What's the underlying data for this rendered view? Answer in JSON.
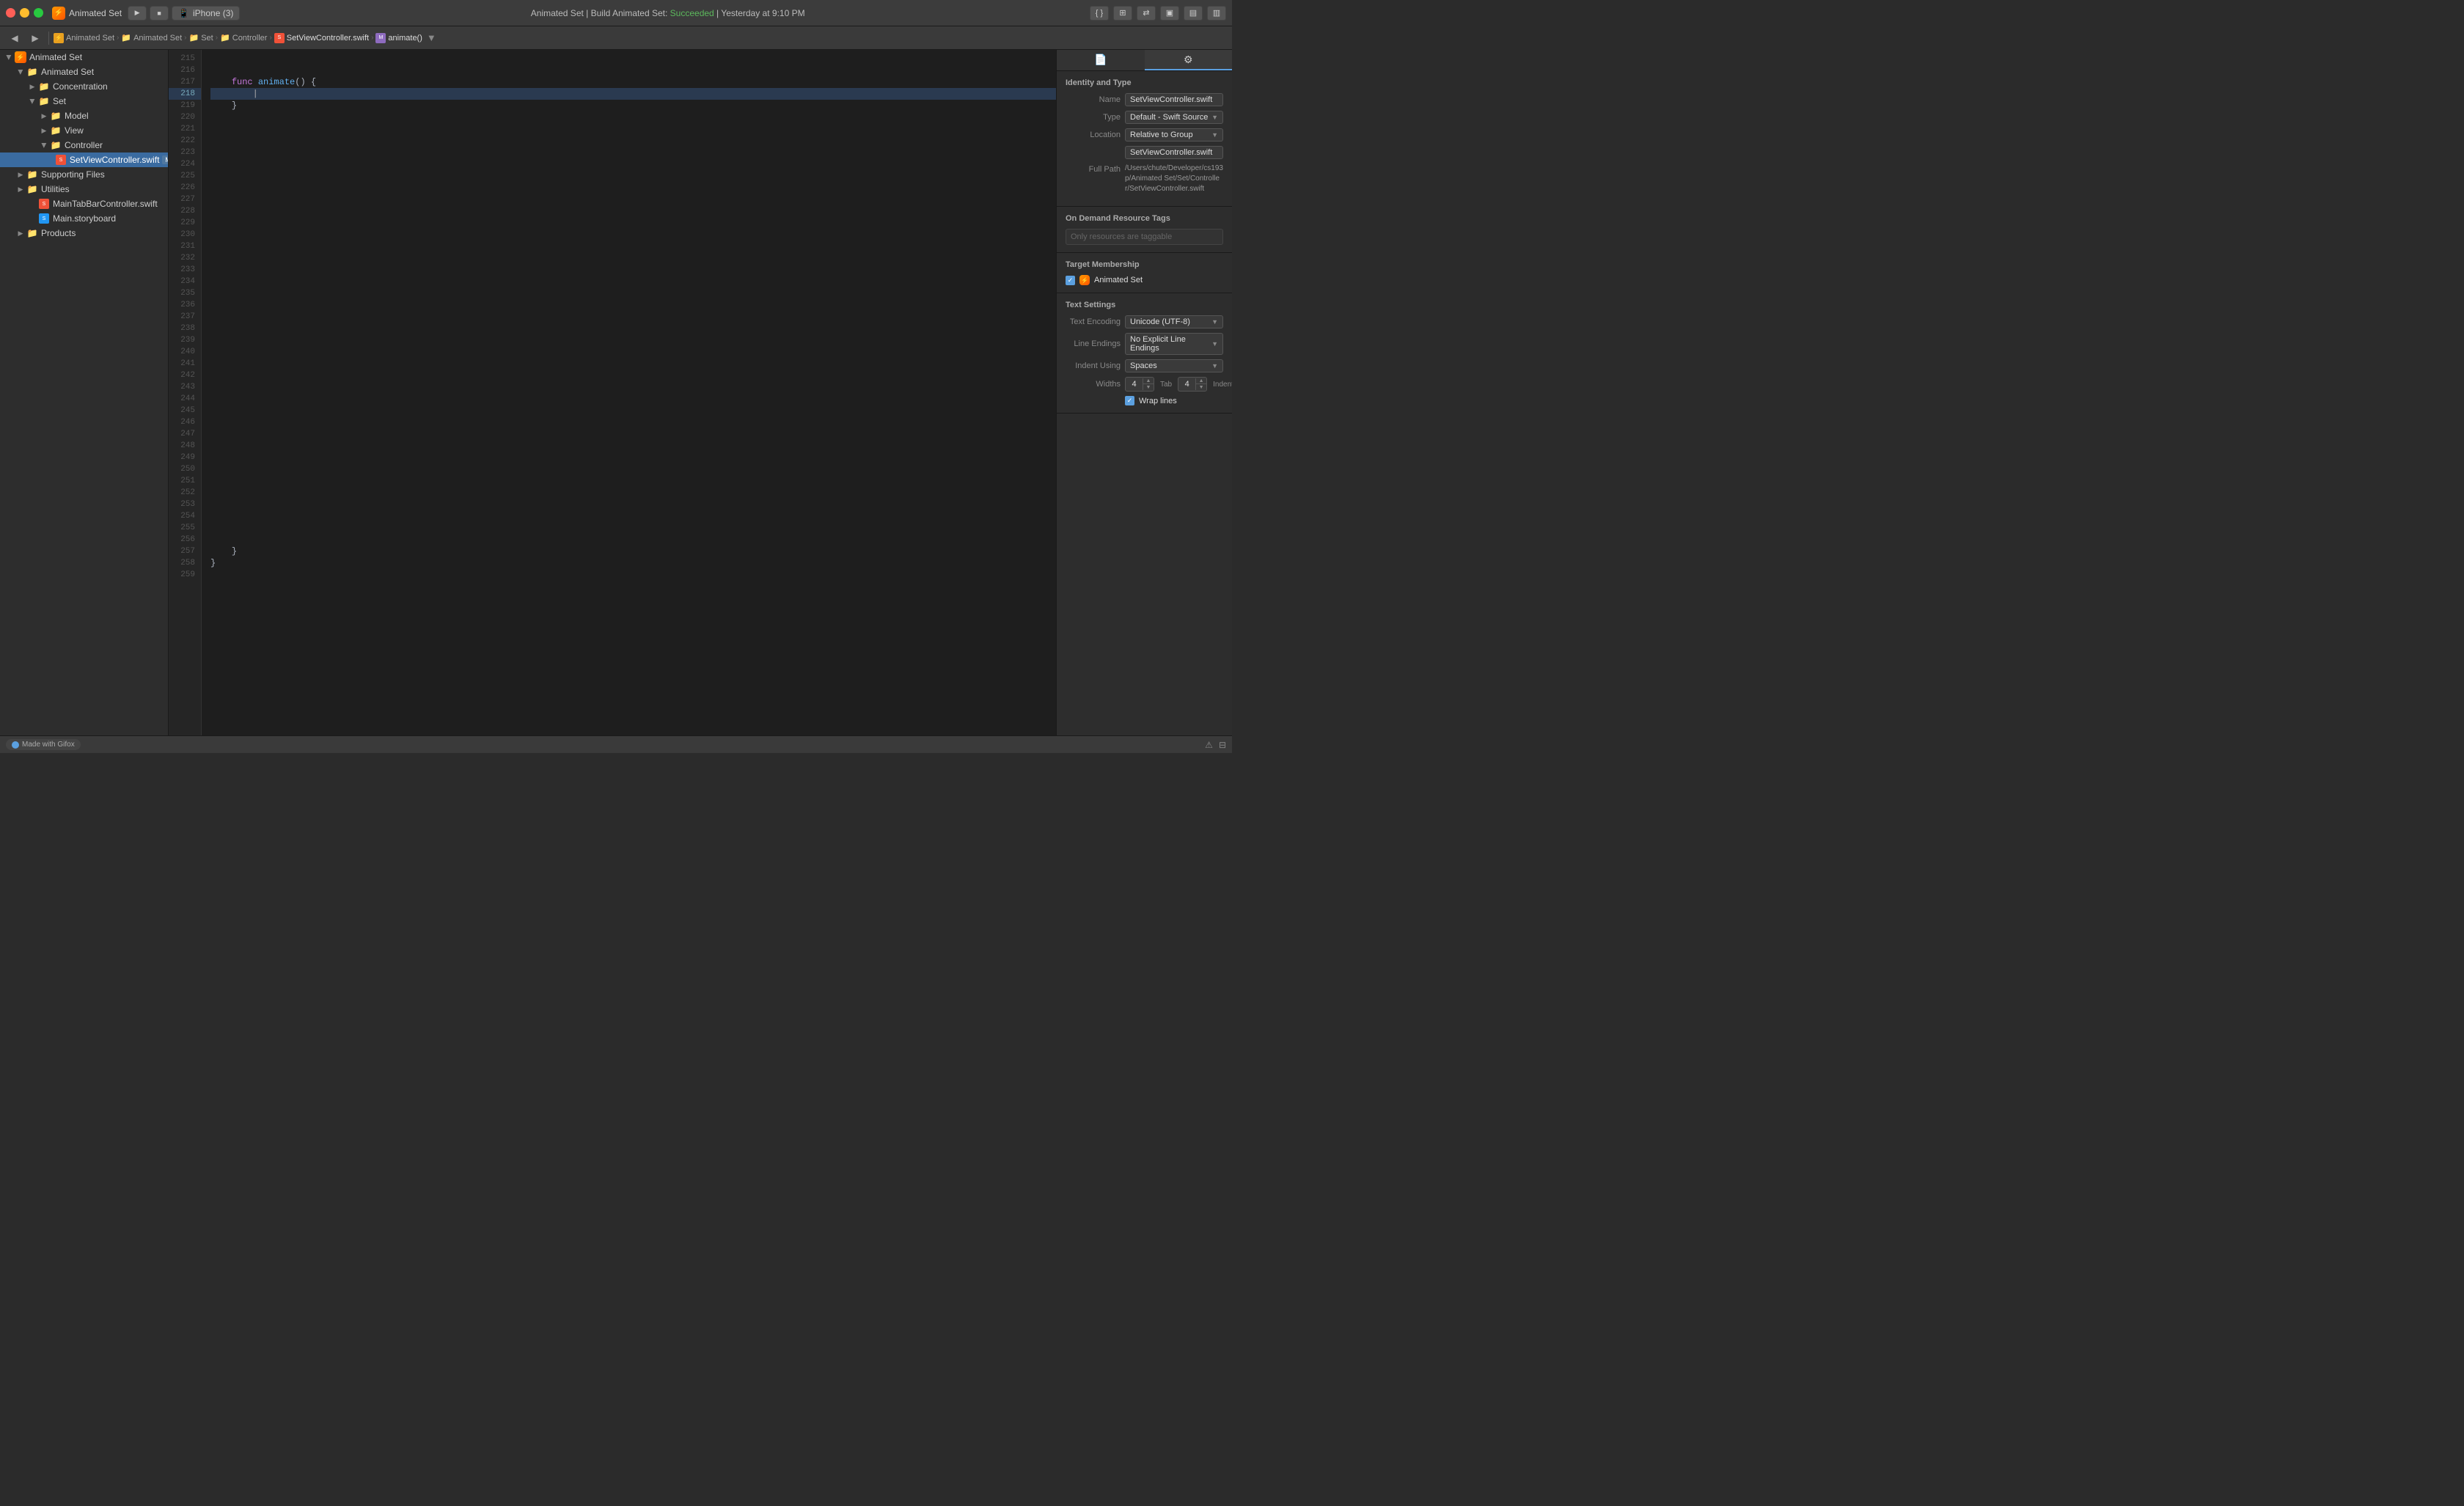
{
  "titleBar": {
    "appName": "Animated Set",
    "deviceName": "iPhone (3)",
    "buildStatus": "Animated Set | Build Animated Set: ",
    "buildResult": "Succeeded",
    "buildTime": "Yesterday at 9:10 PM"
  },
  "breadcrumb": {
    "items": [
      {
        "label": "Animated Set",
        "type": "app"
      },
      {
        "label": "Animated Set",
        "type": "folder"
      },
      {
        "label": "Set",
        "type": "folder"
      },
      {
        "label": "Controller",
        "type": "folder"
      },
      {
        "label": "SetViewController.swift",
        "type": "swift"
      },
      {
        "label": "animate()",
        "type": "func"
      }
    ]
  },
  "sidebar": {
    "items": [
      {
        "label": "Animated Set",
        "level": 0,
        "type": "root",
        "expanded": true
      },
      {
        "label": "Animated Set",
        "level": 1,
        "type": "group",
        "expanded": true
      },
      {
        "label": "Concentration",
        "level": 2,
        "type": "folder",
        "expanded": false
      },
      {
        "label": "Set",
        "level": 2,
        "type": "folder",
        "expanded": true
      },
      {
        "label": "Model",
        "level": 3,
        "type": "folder",
        "expanded": false
      },
      {
        "label": "View",
        "level": 3,
        "type": "folder",
        "expanded": false
      },
      {
        "label": "Controller",
        "level": 3,
        "type": "folder",
        "expanded": true
      },
      {
        "label": "SetViewController.swift",
        "level": 4,
        "type": "swift",
        "badge": "M",
        "selected": true
      },
      {
        "label": "Supporting Files",
        "level": 1,
        "type": "folder",
        "expanded": false
      },
      {
        "label": "Utilities",
        "level": 1,
        "type": "folder",
        "expanded": false
      },
      {
        "label": "MainTabBarController.swift",
        "level": 2,
        "type": "swift"
      },
      {
        "label": "Main.storyboard",
        "level": 2,
        "type": "storyboard"
      },
      {
        "label": "Products",
        "level": 1,
        "type": "folder",
        "expanded": false
      }
    ]
  },
  "editor": {
    "lineStart": 215,
    "currentLine": 218,
    "lines": [
      {
        "num": 215,
        "content": ""
      },
      {
        "num": 216,
        "content": ""
      },
      {
        "num": 217,
        "content": "    func animate() {"
      },
      {
        "num": 218,
        "content": "        "
      },
      {
        "num": 219,
        "content": "    }"
      },
      {
        "num": 220,
        "content": ""
      },
      {
        "num": 221,
        "content": ""
      },
      {
        "num": 222,
        "content": ""
      },
      {
        "num": 223,
        "content": ""
      },
      {
        "num": 224,
        "content": ""
      },
      {
        "num": 225,
        "content": ""
      },
      {
        "num": 226,
        "content": ""
      },
      {
        "num": 227,
        "content": ""
      },
      {
        "num": 228,
        "content": ""
      },
      {
        "num": 229,
        "content": ""
      },
      {
        "num": 230,
        "content": ""
      },
      {
        "num": 231,
        "content": ""
      },
      {
        "num": 232,
        "content": ""
      },
      {
        "num": 233,
        "content": ""
      },
      {
        "num": 234,
        "content": ""
      },
      {
        "num": 235,
        "content": ""
      },
      {
        "num": 236,
        "content": ""
      },
      {
        "num": 237,
        "content": ""
      },
      {
        "num": 238,
        "content": ""
      },
      {
        "num": 239,
        "content": ""
      },
      {
        "num": 240,
        "content": ""
      },
      {
        "num": 241,
        "content": ""
      },
      {
        "num": 242,
        "content": ""
      },
      {
        "num": 243,
        "content": ""
      },
      {
        "num": 244,
        "content": ""
      },
      {
        "num": 245,
        "content": ""
      },
      {
        "num": 246,
        "content": ""
      },
      {
        "num": 247,
        "content": ""
      },
      {
        "num": 248,
        "content": ""
      },
      {
        "num": 249,
        "content": ""
      },
      {
        "num": 250,
        "content": ""
      },
      {
        "num": 251,
        "content": ""
      },
      {
        "num": 252,
        "content": ""
      },
      {
        "num": 253,
        "content": ""
      },
      {
        "num": 254,
        "content": ""
      },
      {
        "num": 255,
        "content": ""
      },
      {
        "num": 256,
        "content": ""
      },
      {
        "num": 257,
        "content": "    }"
      },
      {
        "num": 258,
        "content": "}"
      },
      {
        "num": 259,
        "content": ""
      }
    ]
  },
  "inspector": {
    "title": "Identity and Type",
    "name": {
      "label": "Name",
      "value": "SetViewController.swift"
    },
    "type": {
      "label": "Type",
      "value": "Default - Swift Source"
    },
    "location": {
      "label": "Location",
      "value": "Relative to Group"
    },
    "locationFile": "SetViewController.swift",
    "fullPath": {
      "label": "Full Path",
      "value": "/Users/chute/Developer/cs193p/Animated Set/Set/Controller/SetViewController.swift"
    },
    "onDemandTags": {
      "title": "On Demand Resource Tags",
      "placeholder": "Only resources are taggable"
    },
    "targetMembership": {
      "title": "Target Membership",
      "member": "Animated Set",
      "checked": true
    },
    "textSettings": {
      "title": "Text Settings",
      "encoding": {
        "label": "Text Encoding",
        "value": "Unicode (UTF-8)"
      },
      "lineEndings": {
        "label": "Line Endings",
        "value": "No Explicit Line Endings"
      },
      "indentUsing": {
        "label": "Indent Using",
        "value": "Spaces"
      },
      "widths": {
        "label": "Widths",
        "tabLabel": "Tab",
        "tabValue": "4",
        "indentLabel": "Indent",
        "indentValue": "4"
      },
      "wrapLines": {
        "label": "Wrap lines",
        "checked": true
      }
    }
  },
  "statusBar": {
    "gifxLabel": "Made with Gifox"
  }
}
